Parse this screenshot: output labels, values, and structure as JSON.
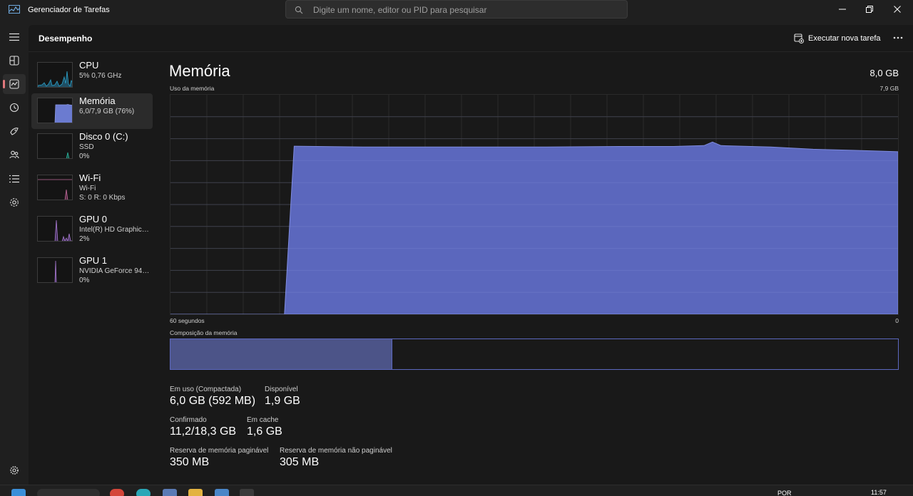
{
  "window": {
    "title": "Gerenciador de Tarefas",
    "search_placeholder": "Digite um nome, editor ou PID para pesquisar"
  },
  "rail": {
    "items": [
      "menu-icon",
      "processes-icon",
      "performance-icon",
      "history-icon",
      "startup-icon",
      "users-icon",
      "details-icon",
      "services-icon"
    ],
    "settings": "settings-icon"
  },
  "header": {
    "title": "Desempenho",
    "run_task": "Executar nova tarefa",
    "more": "more-icon"
  },
  "perf_items": [
    {
      "name": "CPU",
      "sub1": "5% 0,76 GHz",
      "sub2": "",
      "color": "#2aa1c9"
    },
    {
      "name": "Memória",
      "sub1": "6,0/7,9 GB (76%)",
      "sub2": "",
      "color": "#6b7bd0"
    },
    {
      "name": "Disco 0 (C:)",
      "sub1": "SSD",
      "sub2": "0%",
      "color": "#2ab39d"
    },
    {
      "name": "Wi-Fi",
      "sub1": "Wi-Fi",
      "sub2": "S: 0 R: 0 Kbps",
      "color": "#c06a9a"
    },
    {
      "name": "GPU 0",
      "sub1": "Intel(R) HD Graphics ...",
      "sub2": "2%",
      "color": "#a778d0"
    },
    {
      "name": "GPU 1",
      "sub1": "NVIDIA GeForce 940...",
      "sub2": "0%",
      "color": "#a778d0"
    }
  ],
  "detail": {
    "title": "Memória",
    "total": "8,0 GB",
    "graph_label": "Uso da memória",
    "graph_max": "7,9 GB",
    "axis_left": "60 segundos",
    "axis_right": "0",
    "composition_label": "Composição da memória",
    "composition_in_use_fraction": 0.305,
    "accent": "#6b7bd0",
    "stats": {
      "in_use_label": "Em uso (Compactada)",
      "in_use_value": "6,0 GB (592 MB)",
      "available_label": "Disponível",
      "available_value": "1,9 GB",
      "committed_label": "Confirmado",
      "committed_value": "11,2/18,3 GB",
      "cached_label": "Em cache",
      "cached_value": "1,6 GB",
      "paged_label": "Reserva de memória paginável",
      "paged_value": "350 MB",
      "nonpaged_label": "Reserva de memória não paginável",
      "nonpaged_value": "305 MB"
    }
  },
  "chart_data": {
    "type": "area",
    "x": [
      60,
      50.6,
      49.8,
      44,
      38,
      29,
      23,
      18.5,
      16,
      15.3,
      14.6,
      10.5,
      7,
      3.5,
      0
    ],
    "values": [
      0,
      0,
      6.05,
      6.02,
      6.02,
      6.02,
      6.04,
      6.04,
      6.07,
      6.2,
      6.07,
      6.02,
      5.94,
      5.9,
      5.85
    ],
    "ylim": [
      0,
      7.9
    ],
    "xlim": [
      60,
      0
    ],
    "grid": true
  },
  "taskbar": {
    "lang": "POR",
    "time": "11:57"
  }
}
